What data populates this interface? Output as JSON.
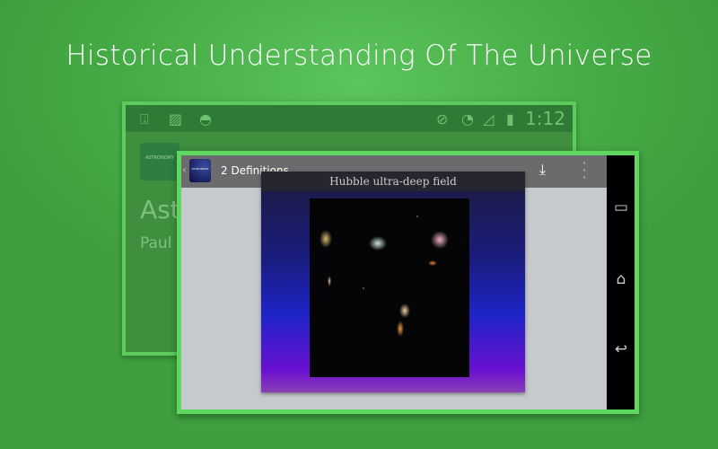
{
  "headline": "Historical Understanding Of The Universe",
  "background_app": {
    "status_bar": {
      "time": "1:12",
      "icons": [
        "download-icon",
        "image-icon",
        "android-icon",
        "mute-icon",
        "wifi-icon",
        "signal-icon",
        "battery-icon"
      ]
    },
    "title_fragment": "Ast",
    "author_fragment": "Paul"
  },
  "foreground_app": {
    "action_bar": {
      "title": "2  Definitions",
      "download_icon": "download-icon",
      "menu_icon": "overflow-menu-icon"
    },
    "slide": {
      "caption": "Hubble ultra-deep field"
    },
    "nav_bar": [
      "recent-apps-icon",
      "home-icon",
      "back-icon"
    ]
  },
  "colors": {
    "background": "#46ac46",
    "card_border": "#5ed75e",
    "action_bar": "#6b6b6d"
  }
}
